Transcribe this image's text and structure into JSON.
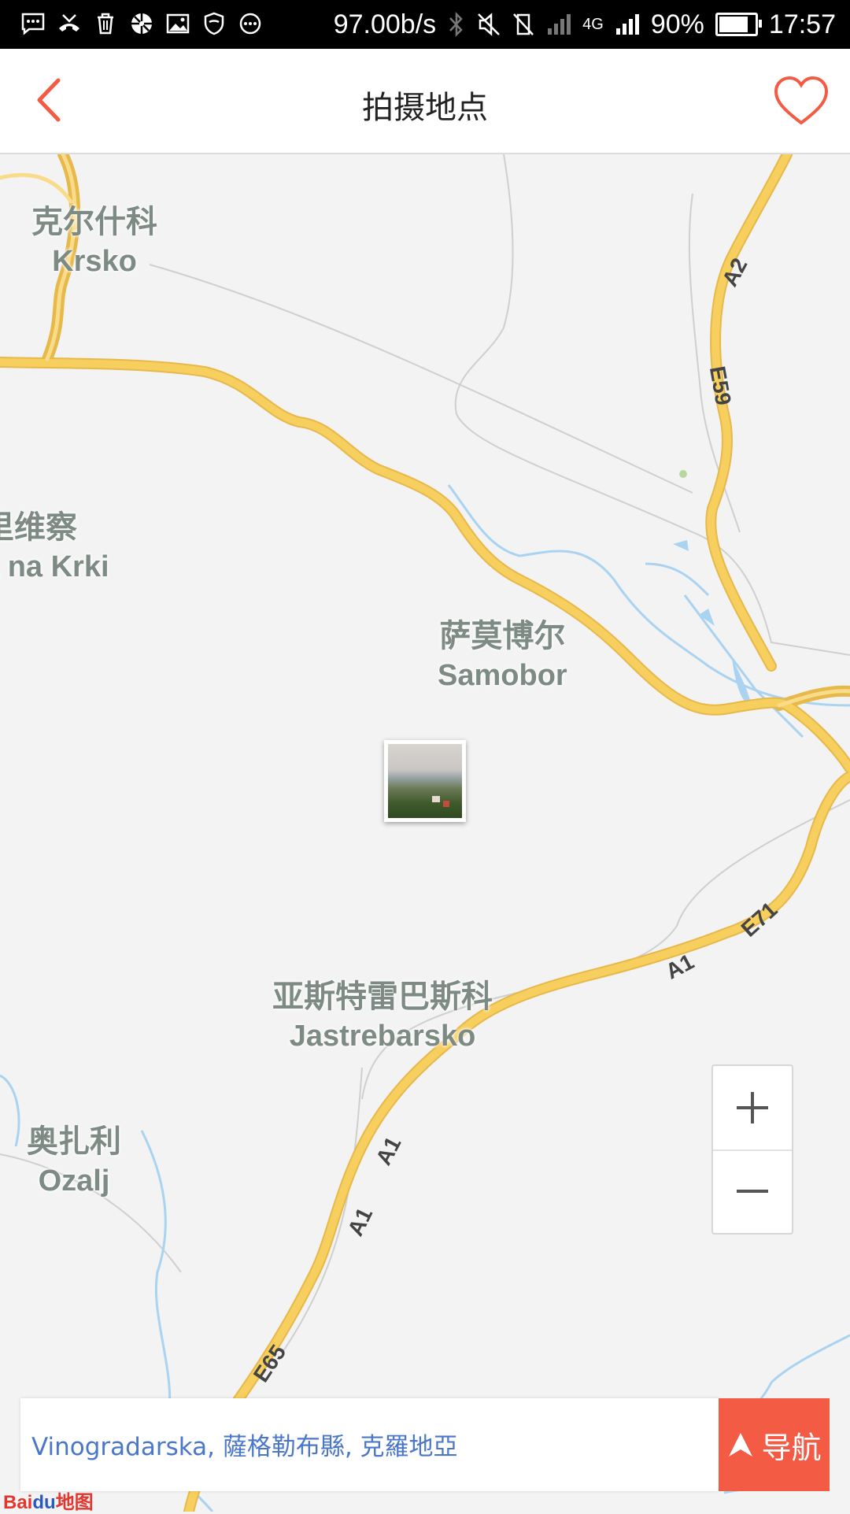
{
  "status_bar": {
    "net_speed": "97.00b/s",
    "network": "4G",
    "battery": "90%",
    "battery_level": 0.9,
    "time": "17:57",
    "left_icons": [
      "message-icon",
      "missed-call-icon",
      "trash-icon",
      "aperture-icon",
      "image-icon",
      "shield-icon",
      "more-dots-icon"
    ],
    "right_icons": [
      "bluetooth-icon",
      "mute-icon",
      "vibrate-off-icon",
      "signal-icon",
      "signal-icon",
      "battery-icon"
    ]
  },
  "header": {
    "title": "拍摄地点",
    "back_icon": "chevron-left-icon",
    "favorite_icon": "heart-icon",
    "accent_color": "#f35b44"
  },
  "map": {
    "cities": [
      {
        "id": "krsko",
        "zh": "克尔什科",
        "en": "Krsko"
      },
      {
        "id": "kostanjevica",
        "zh": "里维察",
        "en": "a na Krki"
      },
      {
        "id": "samobor",
        "zh": "萨莫博尔",
        "en": "Samobor"
      },
      {
        "id": "jastrebarsko",
        "zh": "亚斯特雷巴斯科",
        "en": "Jastrebarsko"
      },
      {
        "id": "ozalj",
        "zh": "奥扎利",
        "en": "Ozalj"
      }
    ],
    "road_labels": [
      "A2",
      "E59",
      "E71",
      "A1",
      "A1",
      "A1",
      "E65"
    ],
    "road_color": "#f7cf5e",
    "water_color": "#a9d3f0",
    "photo_marker_icon": "photo-thumbnail-icon"
  },
  "zoom": {
    "in_icon": "plus-icon",
    "out_icon": "minus-icon"
  },
  "address": {
    "text": "Vinogradarska, 薩格勒布縣, 克羅地亞"
  },
  "nav_button": {
    "label": "导航",
    "icon": "navigation-arrow-icon"
  },
  "logo": {
    "brand_a": "Bai",
    "brand_b": "du",
    "brand_c": "地图"
  }
}
